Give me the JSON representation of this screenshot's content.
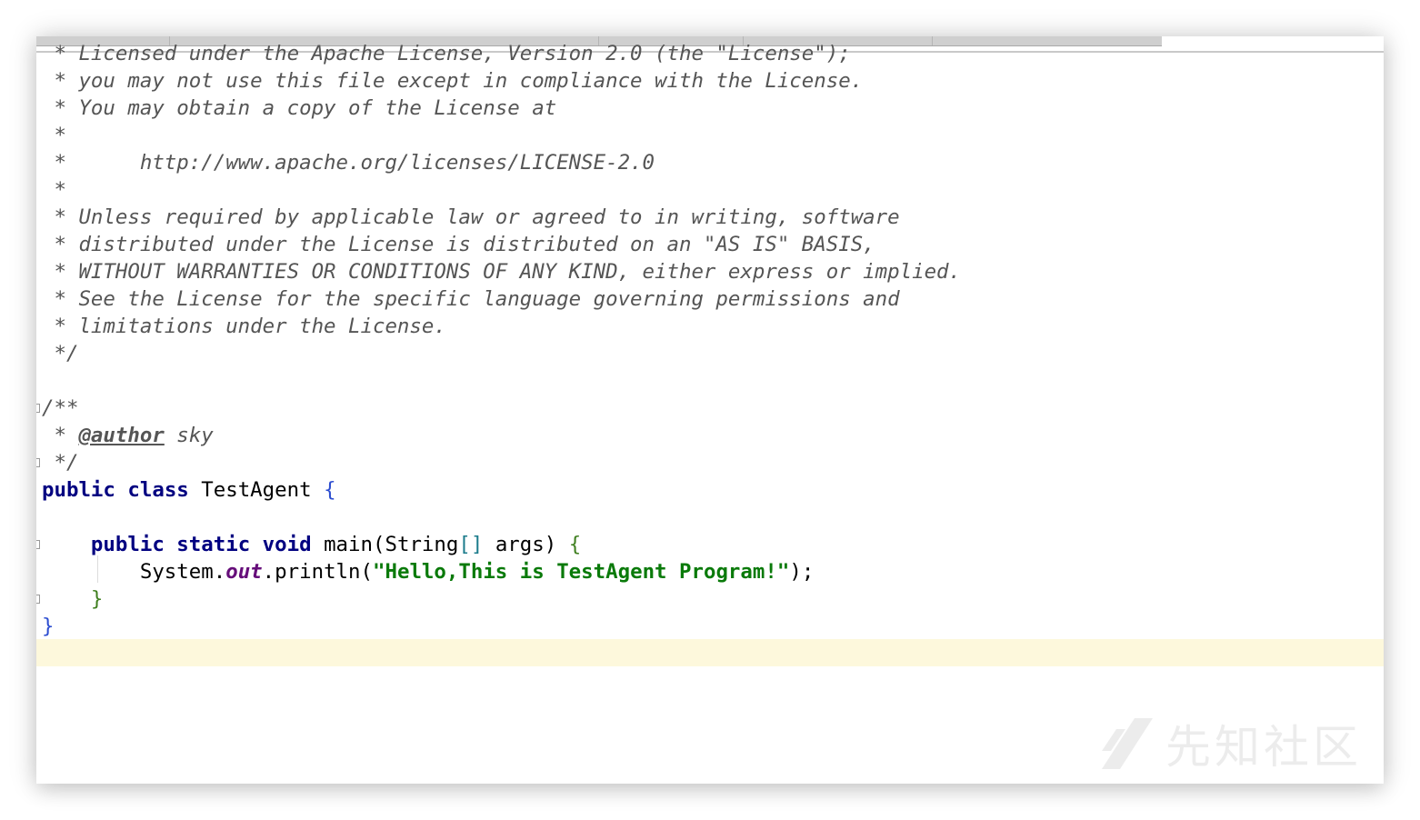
{
  "editor": {
    "header_lines": [
      " * Licensed under the Apache License, Version 2.0 (the \"License\");",
      " * you may not use this file except in compliance with the License.",
      " * You may obtain a copy of the License at",
      " *",
      " *      http://www.apache.org/licenses/LICENSE-2.0",
      " *",
      " * Unless required by applicable law or agreed to in writing, software",
      " * distributed under the License is distributed on an \"AS IS\" BASIS,",
      " * WITHOUT WARRANTIES OR CONDITIONS OF ANY KIND, either express or implied.",
      " * See the License for the specific language governing permissions and",
      " * limitations under the License.",
      " */"
    ],
    "javadoc": {
      "open": "/**",
      "prefix": " * ",
      "author_tag": "@author",
      "author_name": " sky",
      "close": " */"
    },
    "class_decl": {
      "kw_public": "public",
      "kw_class": "class",
      "name": "TestAgent",
      "open_brace": "{"
    },
    "main_decl": {
      "kw_public": "public",
      "kw_static": "static",
      "kw_void": "void",
      "name": "main(String",
      "brackets": "[]",
      "args": " args) ",
      "open_brace": "{"
    },
    "print_stmt": {
      "receiver": "System.",
      "field": "out",
      "call": ".println(",
      "string": "\"Hello,This is TestAgent Program!\"",
      "end": ");"
    },
    "method_close": "}",
    "class_close": "}"
  },
  "watermark": {
    "text": "先知社区",
    "icon": "xianzhi-logo-icon"
  }
}
